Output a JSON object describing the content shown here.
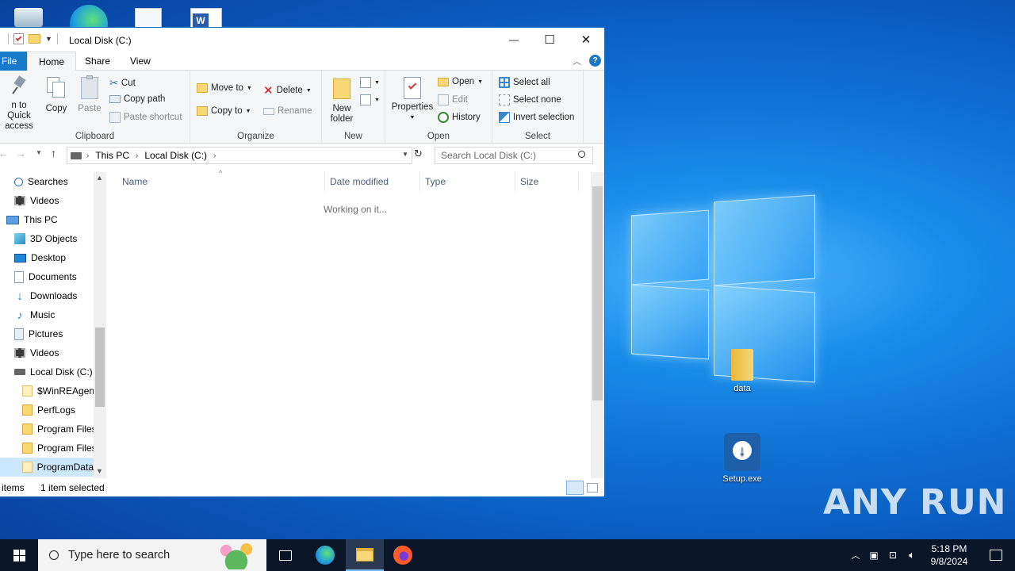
{
  "window": {
    "title": "Local Disk (C:)",
    "controls": {
      "minimize": "—",
      "maximize": "☐",
      "close": "✕"
    }
  },
  "ribbon_tabs": [
    "File",
    "Home",
    "Share",
    "View"
  ],
  "ribbon": {
    "clipboard": {
      "pin_label_1": "n to Quick",
      "pin_label_2": "access",
      "copy": "Copy",
      "paste": "Paste",
      "cut": "Cut",
      "copy_path": "Copy path",
      "paste_shortcut": "Paste shortcut",
      "group": "Clipboard"
    },
    "organize": {
      "move_to": "Move to",
      "copy_to": "Copy to",
      "delete": "Delete",
      "rename": "Rename",
      "group": "Organize"
    },
    "new": {
      "new_folder_1": "New",
      "new_folder_2": "folder",
      "group": "New"
    },
    "open": {
      "properties": "Properties",
      "open": "Open",
      "edit": "Edit",
      "history": "History",
      "group": "Open"
    },
    "select": {
      "select_all": "Select all",
      "select_none": "Select none",
      "invert_selection": "Invert selection",
      "group": "Select"
    }
  },
  "address": {
    "crumbs": [
      "This PC",
      "Local Disk (C:)"
    ],
    "search_placeholder": "Search Local Disk (C:)"
  },
  "nav_items": [
    {
      "label": "Searches",
      "icon": "search-icon"
    },
    {
      "label": "Videos",
      "icon": "video-icon"
    },
    {
      "label": "This PC",
      "icon": "computer-icon"
    },
    {
      "label": "3D Objects",
      "icon": "cube-icon"
    },
    {
      "label": "Desktop",
      "icon": "desktop-icon"
    },
    {
      "label": "Documents",
      "icon": "document-icon"
    },
    {
      "label": "Downloads",
      "icon": "download-icon"
    },
    {
      "label": "Music",
      "icon": "music-icon"
    },
    {
      "label": "Pictures",
      "icon": "picture-icon"
    },
    {
      "label": "Videos",
      "icon": "video-icon"
    },
    {
      "label": "Local Disk (C:)",
      "icon": "drive-icon"
    },
    {
      "label": "$WinREAgent",
      "icon": "folder-icon"
    },
    {
      "label": "PerfLogs",
      "icon": "folder-icon"
    },
    {
      "label": "Program Files",
      "icon": "folder-icon"
    },
    {
      "label": "Program Files",
      "icon": "folder-icon"
    },
    {
      "label": "ProgramData",
      "icon": "folder-icon"
    }
  ],
  "columns": [
    "Name",
    "Date modified",
    "Type",
    "Size"
  ],
  "content": {
    "loading_text": "Working on it..."
  },
  "status": {
    "items": "items",
    "selected": "1 item selected"
  },
  "desktop": {
    "icons": [
      {
        "label": "data",
        "icon": "folder-icon"
      },
      {
        "label": "Setup.exe",
        "icon": "installer-icon"
      }
    ],
    "watermark": "ANY RUN"
  },
  "taskbar": {
    "search_placeholder": "Type here to search",
    "time": "5:18 PM",
    "date": "9/8/2024"
  },
  "colors": {
    "accent": "#1979ca",
    "taskbar": "#0a1527",
    "desktop_bg": "#0f6fd2"
  }
}
